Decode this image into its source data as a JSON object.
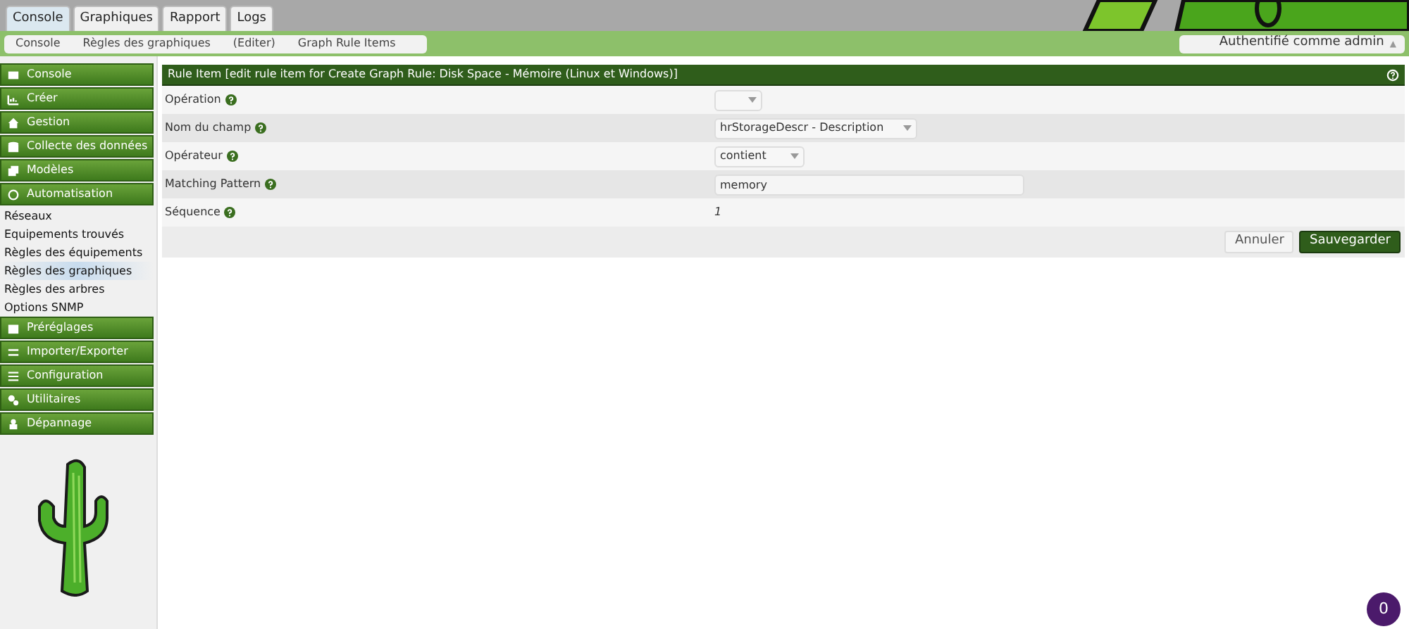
{
  "tabs": [
    {
      "label": "Console",
      "selected": true
    },
    {
      "label": "Graphiques",
      "selected": false
    },
    {
      "label": "Rapport",
      "selected": false
    },
    {
      "label": "Logs",
      "selected": false
    }
  ],
  "breadcrumbs": [
    "Console",
    "Règles des graphiques",
    "(Editer)",
    "Graph Rule Items"
  ],
  "user_menu": {
    "label": "Authentifié comme admin",
    "caret": "▲"
  },
  "sidebar": {
    "items": [
      {
        "kind": "section",
        "label": "Console",
        "selected": false
      },
      {
        "kind": "section",
        "label": "Créer",
        "selected": false
      },
      {
        "kind": "section",
        "label": "Gestion",
        "selected": false
      },
      {
        "kind": "section",
        "label": "Collecte des données",
        "selected": false
      },
      {
        "kind": "section",
        "label": "Modèles",
        "selected": false
      },
      {
        "kind": "section",
        "label": "Automatisation",
        "selected": false
      },
      {
        "kind": "link",
        "label": "Réseaux",
        "selected": false
      },
      {
        "kind": "link",
        "label": "Equipements trouvés",
        "selected": false
      },
      {
        "kind": "link",
        "label": "Règles des équipements",
        "selected": false
      },
      {
        "kind": "link",
        "label": "Règles des graphiques",
        "selected": true
      },
      {
        "kind": "link",
        "label": "Règles des arbres",
        "selected": false
      },
      {
        "kind": "link",
        "label": "Options SNMP",
        "selected": false
      },
      {
        "kind": "section",
        "label": "Préréglages",
        "selected": false
      },
      {
        "kind": "section",
        "label": "Importer/Exporter",
        "selected": false
      },
      {
        "kind": "section",
        "label": "Configuration",
        "selected": false
      },
      {
        "kind": "section",
        "label": "Utilitaires",
        "selected": false
      },
      {
        "kind": "section",
        "label": "Dépannage",
        "selected": false
      }
    ]
  },
  "panel": {
    "title": "Rule Item [edit rule item for Create Graph Rule: Disk Space - Mémoire (Linux et Windows)]",
    "fields": [
      {
        "label": "Opération",
        "kind": "select"
      },
      {
        "label": "Nom du champ",
        "kind": "select",
        "value": "hrStorageDescr - Description"
      },
      {
        "label": "Opérateur",
        "kind": "select",
        "value": "contient"
      },
      {
        "label": "Matching Pattern",
        "kind": "input",
        "value": "memory"
      },
      {
        "label": "Séquence",
        "kind": "text",
        "value": "1"
      }
    ],
    "buttons": [
      {
        "label": "Annuler",
        "kind": "secondary"
      },
      {
        "label": "Sauvegarder",
        "kind": "primary"
      }
    ]
  },
  "notification_badge": "0"
}
